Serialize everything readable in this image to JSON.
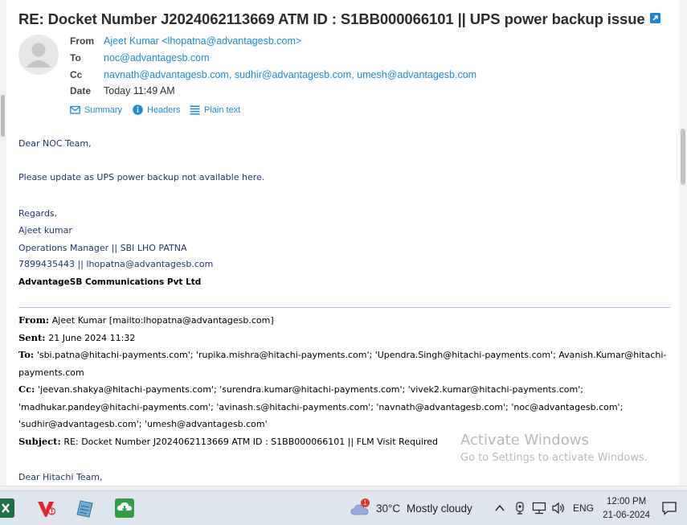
{
  "message": {
    "subject": "RE: Docket Number J2024062113669 ATM ID : S1BB000066101 || UPS power backup issue",
    "labels": {
      "from": "From",
      "to": "To",
      "cc": "Cc",
      "date": "Date"
    },
    "from": "Ajeet Kumar <lhopatna@advantagesb.com>",
    "to": "noc@advantagesb.com",
    "cc": [
      "navnath@advantagesb.com",
      "sudhir@advantagesb.com",
      "umesh@advantagesb.com"
    ],
    "date": "Today 11:49 AM",
    "tools": {
      "summary": "Summary",
      "headers": "Headers",
      "plain": "Plain text"
    }
  },
  "body": {
    "greeting": "Dear NOC Team,",
    "line1": "Please update as UPS power backup not available here.",
    "regards": "Regards,",
    "name": "Ajeet kumar",
    "title": "Operations Manager || SBI LHO PATNA",
    "contact": "7899435443 || lhopatna@advantagesb.com",
    "company": "AdvantageSB Communications Pvt Ltd"
  },
  "quoted": {
    "from_label": "From:",
    "from": "Ajeet Kumar [mailto:lhopatna@advantagesb.com]",
    "sent_label": "Sent:",
    "sent": "21 June 2024 11:32",
    "to_label": "To:",
    "to_line1": "'sbi.patna@hitachi-payments.com'; 'rupika.mishra@hitachi-payments.com'; 'Upendra.Singh@hitachi-payments.com'; Avanish.Kumar@hitachi-",
    "to_line2": "payments.com",
    "cc_label": "Cc:",
    "cc_line1": "'jeevan.shakya@hitachi-payments.com'; 'surendra.kumar@hitachi-payments.com'; 'vivek2.kumar@hitachi-payments.com';",
    "cc_line2": "'madhukar.pandey@hitachi-payments.com'; 'avinash.s@hitachi-payments.com'; 'navnath@advantagesb.com'; 'noc@advantagesb.com';",
    "cc_line3": "'sudhir@advantagesb.com'; 'umesh@advantagesb.com'",
    "subject_label": "Subject:",
    "subject": "RE: Docket Number J2024062113669 ATM ID : S1BB000066101 || FLM Visit Required",
    "greeting": "Dear Hitachi Team,"
  },
  "watermark": {
    "title": "Activate Windows",
    "subtitle": "Go to Settings to activate Windows."
  },
  "taskbar": {
    "apps": [
      "excel-icon",
      "vivaldi-icon",
      "notepad-icon",
      "download-manager-icon"
    ],
    "weather_badge": "1",
    "temperature": "30°C",
    "weather": "Mostly cloudy",
    "language": "ENG",
    "time": "12:00 PM",
    "date": "21-06-2024"
  },
  "colors": {
    "link": "#1d8ad6",
    "signature": "#1f3864",
    "taskbar": "#dfe5ee"
  }
}
